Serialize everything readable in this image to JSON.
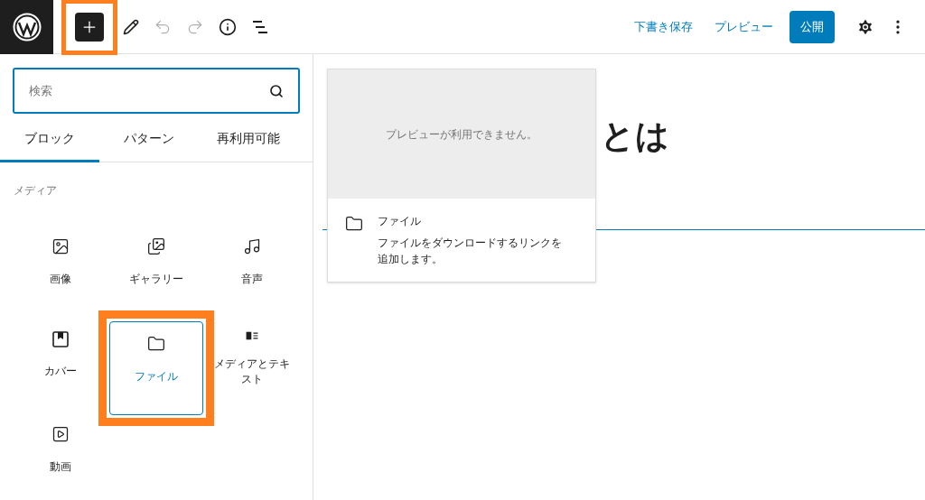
{
  "toolbar": {
    "inserter_highlighted": true,
    "inserter_open": true,
    "undo_disabled": true,
    "redo_disabled": true,
    "save_draft": "下書き保存",
    "preview": "プレビュー",
    "publish": "公開"
  },
  "inserter": {
    "search": {
      "placeholder": "検索"
    },
    "tabs": [
      {
        "label": "ブロック",
        "selected": true
      },
      {
        "label": "パターン",
        "selected": false
      },
      {
        "label": "再利用可能",
        "selected": false
      }
    ],
    "category": "メディア",
    "blocks": [
      {
        "kind": "image",
        "label": "画像",
        "selected": false,
        "highlighted": false
      },
      {
        "kind": "gallery",
        "label": "ギャラリー",
        "selected": false,
        "highlighted": false
      },
      {
        "kind": "audio",
        "label": "音声",
        "selected": false,
        "highlighted": false
      },
      {
        "kind": "cover",
        "label": "カバー",
        "selected": false,
        "highlighted": false
      },
      {
        "kind": "file",
        "label": "ファイル",
        "selected": true,
        "highlighted": true
      },
      {
        "kind": "media-text",
        "label": "メディアとテキスト",
        "selected": false,
        "highlighted": false
      },
      {
        "kind": "video",
        "label": "動画",
        "selected": false,
        "highlighted": false
      }
    ]
  },
  "editor": {
    "title": "とは"
  },
  "block_preview": {
    "message": "プレビューが利用できません。",
    "name": "ファイル",
    "description": "ファイルをダウンロードするリンクを追加します。"
  }
}
